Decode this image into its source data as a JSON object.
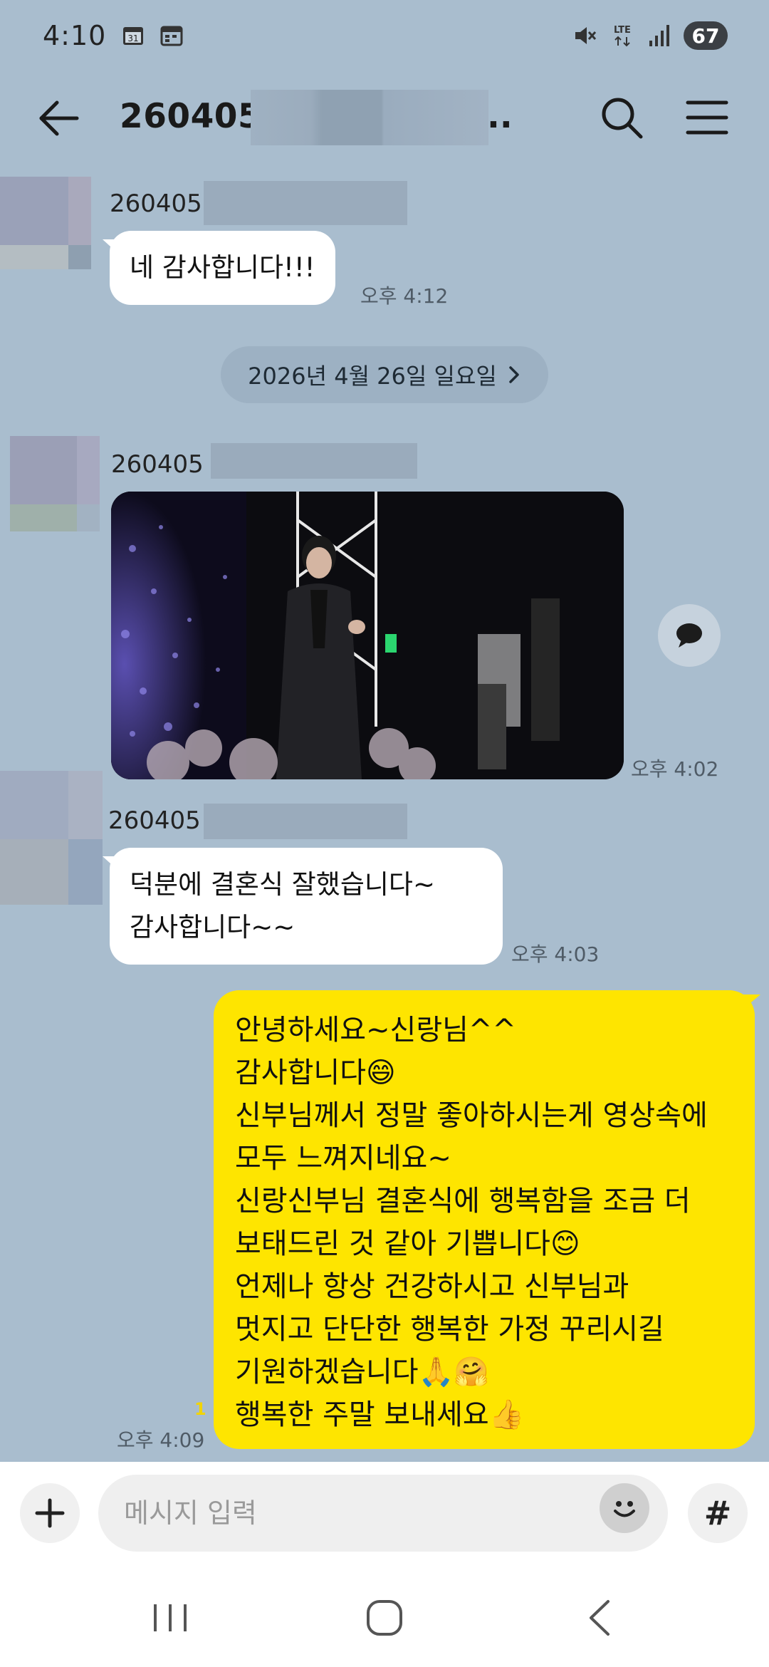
{
  "status_bar": {
    "time": "4:10",
    "calendar_day": "31",
    "network": "LTE",
    "battery": "67"
  },
  "header": {
    "title": "260405",
    "title_suffix": ".."
  },
  "messages": [
    {
      "sender": "260405",
      "text": "네 감사합니다!!!",
      "time": "오후 4:12"
    },
    {
      "sender": "260405",
      "type": "photo",
      "time": "오후 4:02"
    },
    {
      "sender": "260405",
      "lines": [
        "덕분에 결혼식 잘했습니다~",
        "감사합니다~~"
      ],
      "time": "오후 4:03"
    }
  ],
  "date_divider": {
    "label": "2026년 4월 26일 일요일",
    "icon": "chevron-right-icon"
  },
  "my_message": {
    "lines": [
      "안녕하세요~신랑님^^",
      "감사합니다😄",
      "신부님께서 정말 좋아하시는게 영상속에",
      "모두 느껴지네요~",
      "신랑신부님  결혼식에 행복함을 조금 더",
      "보태드린 것 같아 기쁩니다😊",
      "언제나 항상 건강하시고 신부님과",
      "멋지고 단단한 행복한  가정 꾸리시길",
      "기원하겠습니다🙏🤗",
      "행복한 주말 보내세요👍"
    ],
    "unread_count": "1",
    "time": "오후 4:09",
    "bubble_color": "#fee500"
  },
  "input_bar": {
    "placeholder": "메시지 입력",
    "hash_label": "#"
  },
  "colors": {
    "background": "#a9bdce",
    "my_bubble": "#fee500",
    "other_bubble": "#ffffff"
  }
}
